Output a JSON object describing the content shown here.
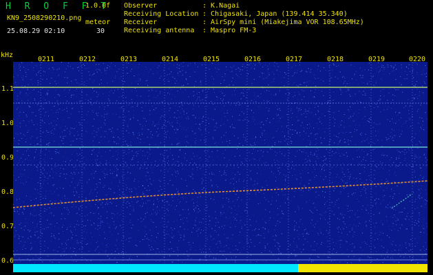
{
  "header": {
    "app_title": "H R O F F T",
    "version": "1.0.0f",
    "filename": "KN9_2508290210.png",
    "meteor_label": "meteor",
    "datetime": "25.08.29 02:10",
    "meteor_count": "30"
  },
  "info": [
    {
      "key": "Observer",
      "value": ": K.Nagai"
    },
    {
      "key": "Receiving Location",
      "value": ": Chigasaki, Japan (139.414 35.340)"
    },
    {
      "key": "Receiver",
      "value": ": AirSpy mini (Miakejima VOR 108.65MHz)"
    },
    {
      "key": "Receiving antenna",
      "value": ": Maspro FM-3"
    }
  ],
  "axis": {
    "unit": "kHz",
    "time_labels": [
      "0211",
      "0212",
      "0213",
      "0214",
      "0215",
      "0216",
      "0217",
      "0218",
      "0219",
      "0220"
    ],
    "freq_ticks": [
      "1.1",
      "1.0",
      "0.9",
      "0.8",
      "0.7",
      "0.6"
    ]
  },
  "colors": {
    "header_green": "#00d23c",
    "header_yellow": "#f0e400",
    "background": "#0a1a8a",
    "cyan_bar": "#00e6ff",
    "yellow_bar": "#f0e400"
  }
}
